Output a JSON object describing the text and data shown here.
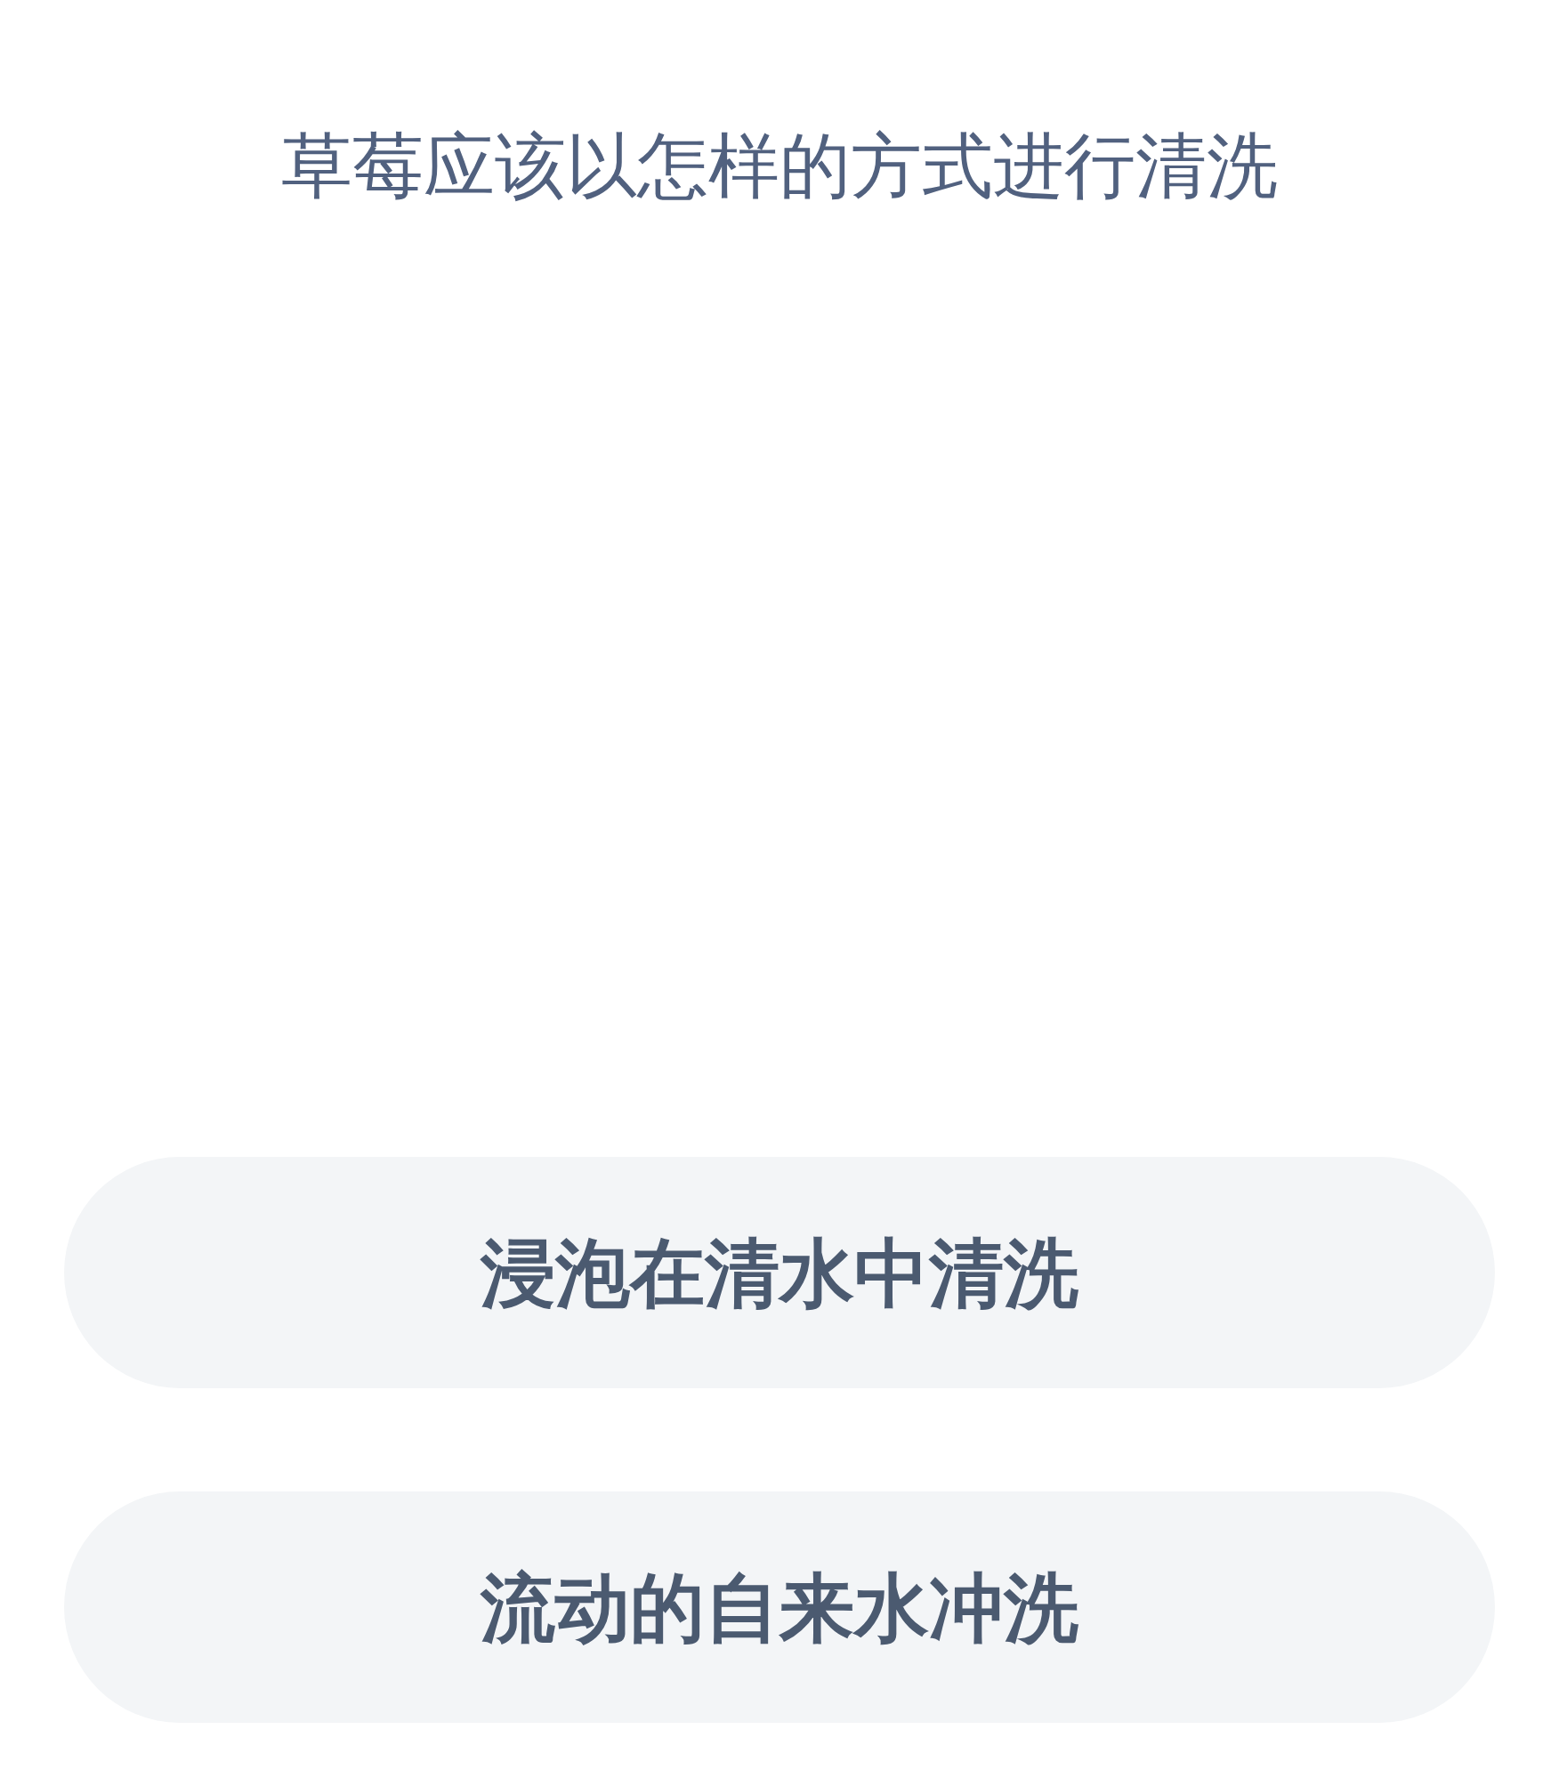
{
  "question": "草莓应该以怎样的方式进行清洗",
  "options": [
    {
      "label": "浸泡在清水中清洗"
    },
    {
      "label": "流动的自来水冲洗"
    }
  ]
}
